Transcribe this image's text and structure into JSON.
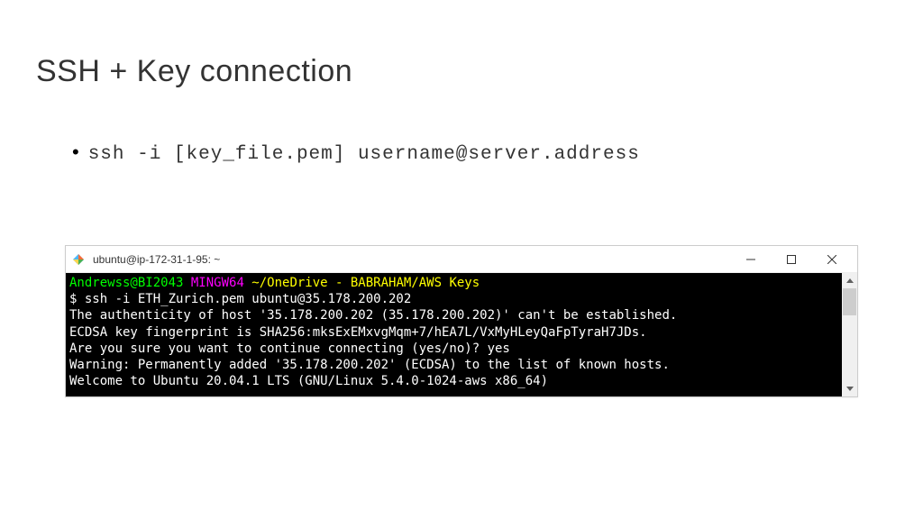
{
  "slide": {
    "title": "SSH + Key connection",
    "bullet": "ssh -i [key_file.pem] username@server.address"
  },
  "window": {
    "title": "ubuntu@ip-172-31-1-95: ~"
  },
  "terminal": {
    "prompt_user": "Andrewss@BI2043",
    "prompt_env": " MINGW64 ",
    "prompt_path": "~/OneDrive - BABRAHAM/AWS Keys",
    "cmd_prefix": "$ ",
    "cmd": "ssh -i ETH_Zurich.pem ubuntu@35.178.200.202",
    "line3": "The authenticity of host '35.178.200.202 (35.178.200.202)' can't be established.",
    "line4": "ECDSA key fingerprint is SHA256:mksExEMxvgMqm+7/hEA7L/VxMyHLeyQaFpTyraH7JDs.",
    "line5": "Are you sure you want to continue connecting (yes/no)? yes",
    "line6": "Warning: Permanently added '35.178.200.202' (ECDSA) to the list of known hosts.",
    "line7": "Welcome to Ubuntu 20.04.1 LTS (GNU/Linux 5.4.0-1024-aws x86_64)"
  }
}
